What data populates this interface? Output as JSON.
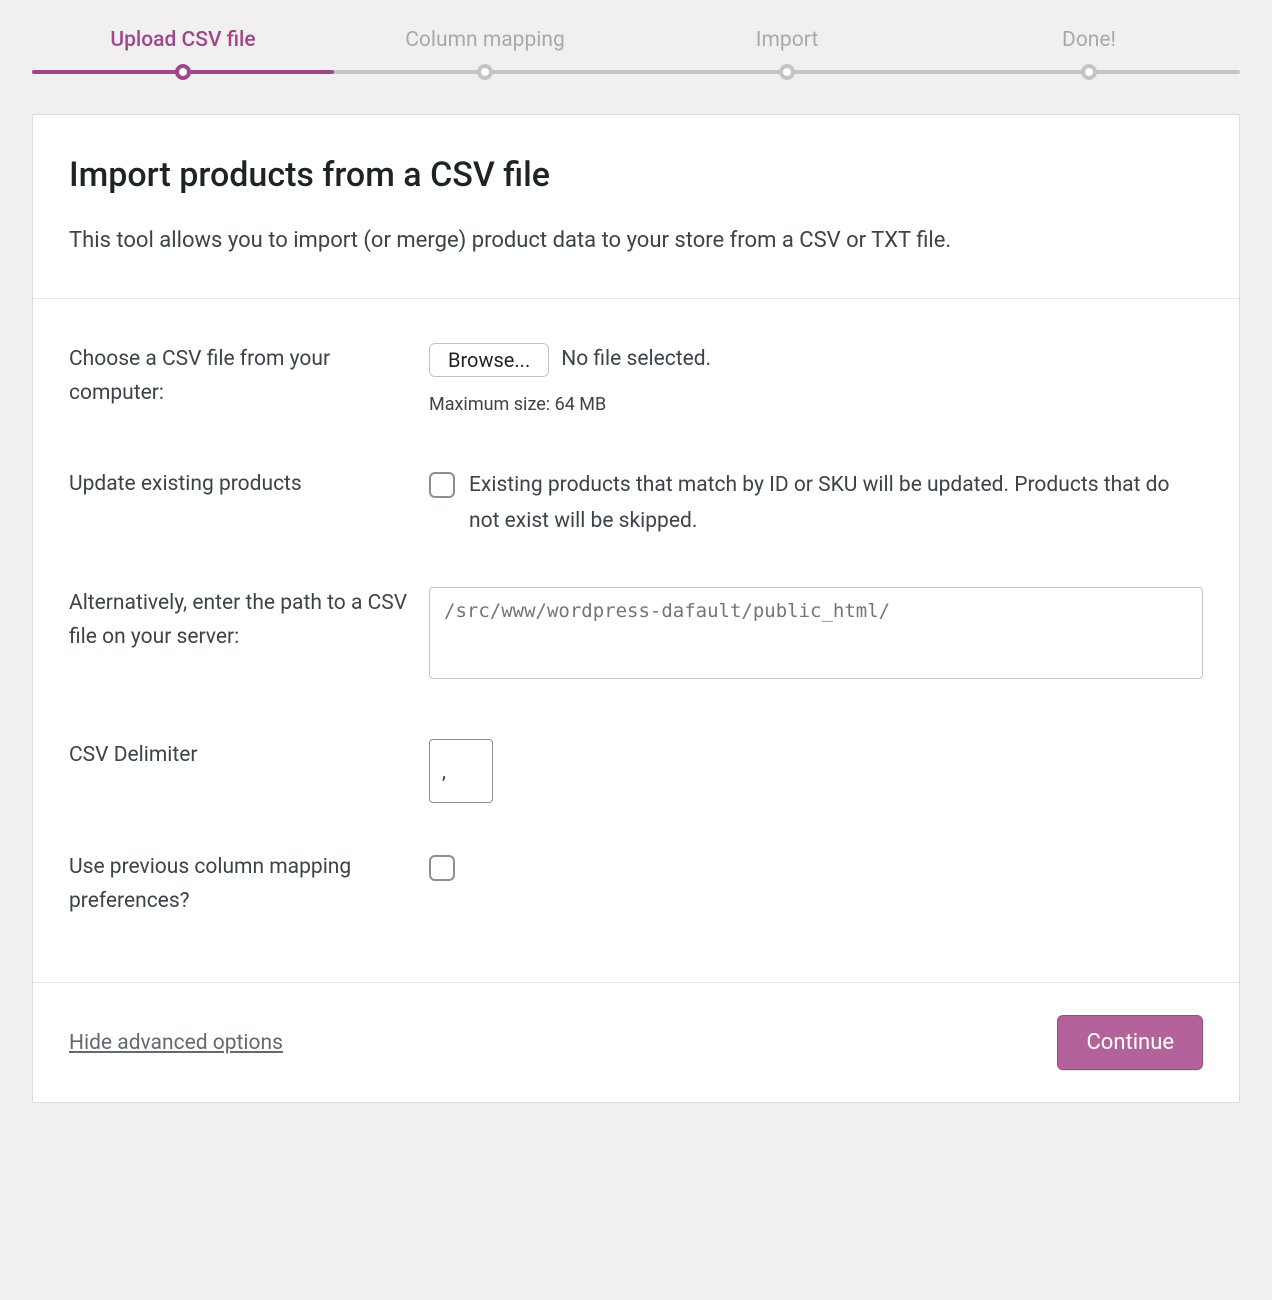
{
  "colors": {
    "accent": "#a3458a",
    "button": "#b4639a"
  },
  "progress": {
    "steps": [
      {
        "label": "Upload CSV file",
        "active": true
      },
      {
        "label": "Column mapping",
        "active": false
      },
      {
        "label": "Import",
        "active": false
      },
      {
        "label": "Done!",
        "active": false
      }
    ]
  },
  "header": {
    "title": "Import products from a CSV file",
    "description": "This tool allows you to import (or merge) product data to your store from a CSV or TXT file."
  },
  "form": {
    "choose_file": {
      "label": "Choose a CSV file from your computer:",
      "browse_label": "Browse...",
      "file_status": "No file selected.",
      "max_size": "Maximum size: 64 MB"
    },
    "update_existing": {
      "label": "Update existing products",
      "description": "Existing products that match by ID or SKU will be updated. Products that do not exist will be skipped.",
      "checked": false
    },
    "server_path": {
      "label": "Alternatively, enter the path to a CSV file on your server:",
      "placeholder": "/src/www/wordpress-dafault/public_html/",
      "value": ""
    },
    "delimiter": {
      "label": "CSV Delimiter",
      "value": ","
    },
    "use_previous": {
      "label": "Use previous column mapping preferences?",
      "checked": false
    }
  },
  "footer": {
    "advanced_link": "Hide advanced options",
    "continue_label": "Continue"
  }
}
